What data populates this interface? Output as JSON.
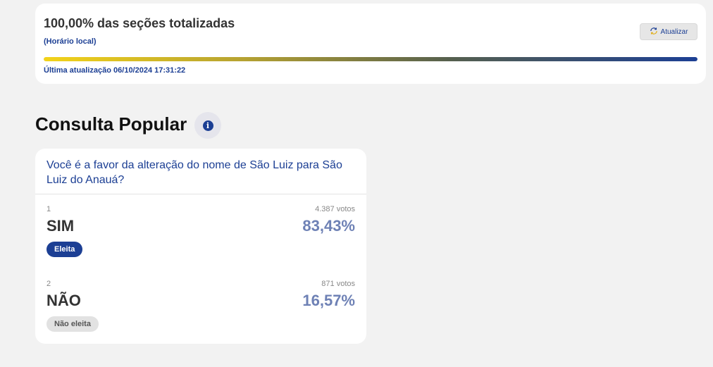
{
  "status": {
    "title": "100,00% das seções totalizadas",
    "local_time_label": "(Horário local)",
    "refresh_label": "Atualizar",
    "progress_percent": 100,
    "last_update": "Última atualização 06/10/2024 17:31:22"
  },
  "section": {
    "title": "Consulta Popular",
    "info_icon": "i"
  },
  "question": {
    "text": "Você é a favor da alteração do nome de São Luiz para São Luiz do Anauá?",
    "options": [
      {
        "number": "1",
        "name": "SIM",
        "votes": "4.387 votos",
        "percent": "83,43%",
        "badge": "Eleita"
      },
      {
        "number": "2",
        "name": "NÃO",
        "votes": "871 votos",
        "percent": "16,57%",
        "badge": "Não eleita"
      }
    ]
  },
  "colors": {
    "accent_blue": "#1c3f94",
    "percent_blue": "#6e81b5",
    "progress_start": "#f3d31a"
  }
}
